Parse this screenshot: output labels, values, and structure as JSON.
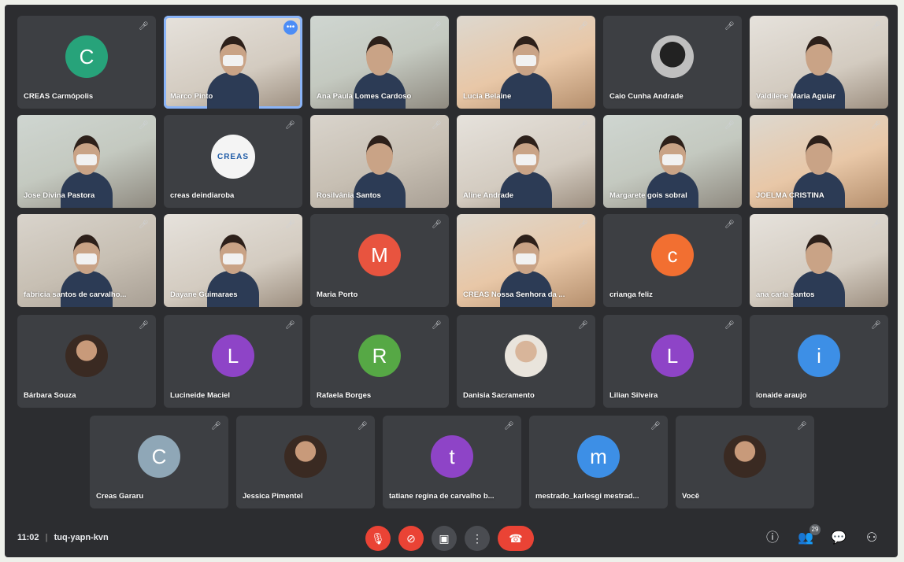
{
  "colors": {
    "meeting_bg": "#2c2d30",
    "tile_bg": "#3d3f43",
    "end_call": "#ea4335",
    "active_speaker": "#8ab4f8"
  },
  "participants": [
    {
      "name": "CREAS Carmópolis",
      "initial": "C",
      "color": "#27a37a",
      "type": "initial"
    },
    {
      "name": "Marco Pinto",
      "type": "video",
      "more": "•••"
    },
    {
      "name": "Ana Paula Lomes Cardoso",
      "type": "video"
    },
    {
      "name": "Lucia Belaine",
      "type": "video"
    },
    {
      "name": "Caio Cunha Andrade",
      "type": "photo"
    },
    {
      "name": "Valdilene Maria Aguiar",
      "type": "video"
    },
    {
      "name": "Jose Divina Pastora",
      "type": "video"
    },
    {
      "name": "creas deindiaroba",
      "type": "logo",
      "logo_text": "CREAS"
    },
    {
      "name": "Rosilvânia Santos",
      "type": "video"
    },
    {
      "name": "Aline Andrade",
      "type": "video"
    },
    {
      "name": "Margarete gois sobral",
      "type": "video"
    },
    {
      "name": "JOELMA CRISTINA",
      "type": "video"
    },
    {
      "name": "fabricia santos de carvalho...",
      "type": "video"
    },
    {
      "name": "Dayane Guimaraes",
      "type": "video"
    },
    {
      "name": "Maria Porto",
      "initial": "M",
      "color": "#e8543f",
      "type": "initial"
    },
    {
      "name": "CREAS Nossa Senhora da ...",
      "type": "video"
    },
    {
      "name": "crianga feliz",
      "initial": "c",
      "color": "#f26f31",
      "type": "initial"
    },
    {
      "name": "ana carla santos",
      "type": "video"
    },
    {
      "name": "Bárbara Souza",
      "type": "photo"
    },
    {
      "name": "Lucineide Maciel",
      "initial": "L",
      "color": "#8e44c7",
      "type": "initial"
    },
    {
      "name": "Rafaela Borges",
      "initial": "R",
      "color": "#56a845",
      "type": "initial"
    },
    {
      "name": "Danisia Sacramento",
      "type": "photo"
    },
    {
      "name": "Lilian Silveira",
      "initial": "L",
      "color": "#8e44c7",
      "type": "initial"
    },
    {
      "name": "ionaide araujo",
      "initial": "i",
      "color": "#3d8fe6",
      "type": "initial"
    },
    {
      "name": "Creas Gararu",
      "initial": "C",
      "color": "#8fa7b7",
      "type": "initial"
    },
    {
      "name": "Jessica Pimentel",
      "type": "photo"
    },
    {
      "name": "tatiane regina de carvalho b...",
      "initial": "t",
      "color": "#8e44c7",
      "type": "initial"
    },
    {
      "name": "mestrado_karlesgi mestrad...",
      "initial": "m",
      "color": "#3d8fe6",
      "type": "initial"
    },
    {
      "name": "Você",
      "type": "photo"
    }
  ],
  "bottom_bar": {
    "time": "11:02",
    "meeting_code": "tuq-yapn-kvn",
    "controls": {
      "mic_icon": "mic-off",
      "camera_icon": "camera-off",
      "present_icon": "present",
      "more_icon": "more-vertical",
      "end_icon": "end-call"
    },
    "participants_count": "29",
    "mic_glyph": "🎙",
    "cam_glyph": "⊘",
    "present_glyph": "▣",
    "more_glyph": "⋮",
    "end_glyph": "☎",
    "info_glyph": "ⓘ",
    "people_glyph": "👥",
    "chat_glyph": "💬",
    "activities_glyph": "⚇"
  }
}
